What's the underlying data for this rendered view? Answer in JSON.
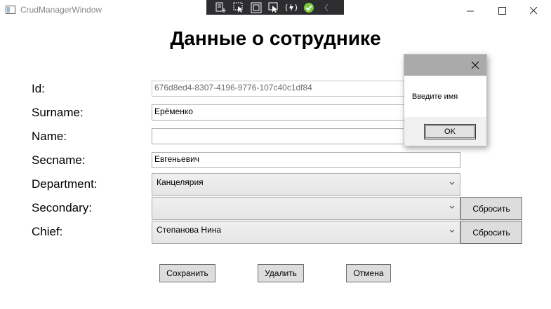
{
  "window": {
    "title": "CrudManagerWindow"
  },
  "page": {
    "heading": "Данные о сотруднике"
  },
  "labels": {
    "id": "Id:",
    "surname": "Surname:",
    "name": "Name:",
    "secname": "Secname:",
    "department": "Department:",
    "secondary": "Secondary:",
    "chief": "Chief:"
  },
  "fields": {
    "id": "676d8ed4-8307-4196-9776-107c40c1df84",
    "surname": "Ерёменко",
    "name": "",
    "secname": "Евгеньевич",
    "department": "Канцелярия",
    "secondary": "",
    "chief": "Степанова Нина"
  },
  "buttons": {
    "reset_secondary": "Сбросить",
    "reset_chief": "Сбросить",
    "save": "Сохранить",
    "delete": "Удалить",
    "cancel": "Отмена"
  },
  "dialog": {
    "message": "Введите имя",
    "ok": "OK"
  },
  "icons": [
    "live-visual-tree-icon",
    "select-element-icon",
    "display-layout-adorners-icon",
    "track-focus-icon",
    "hot-reload-icon",
    "xaml-ok-icon",
    "collapse-icon"
  ]
}
